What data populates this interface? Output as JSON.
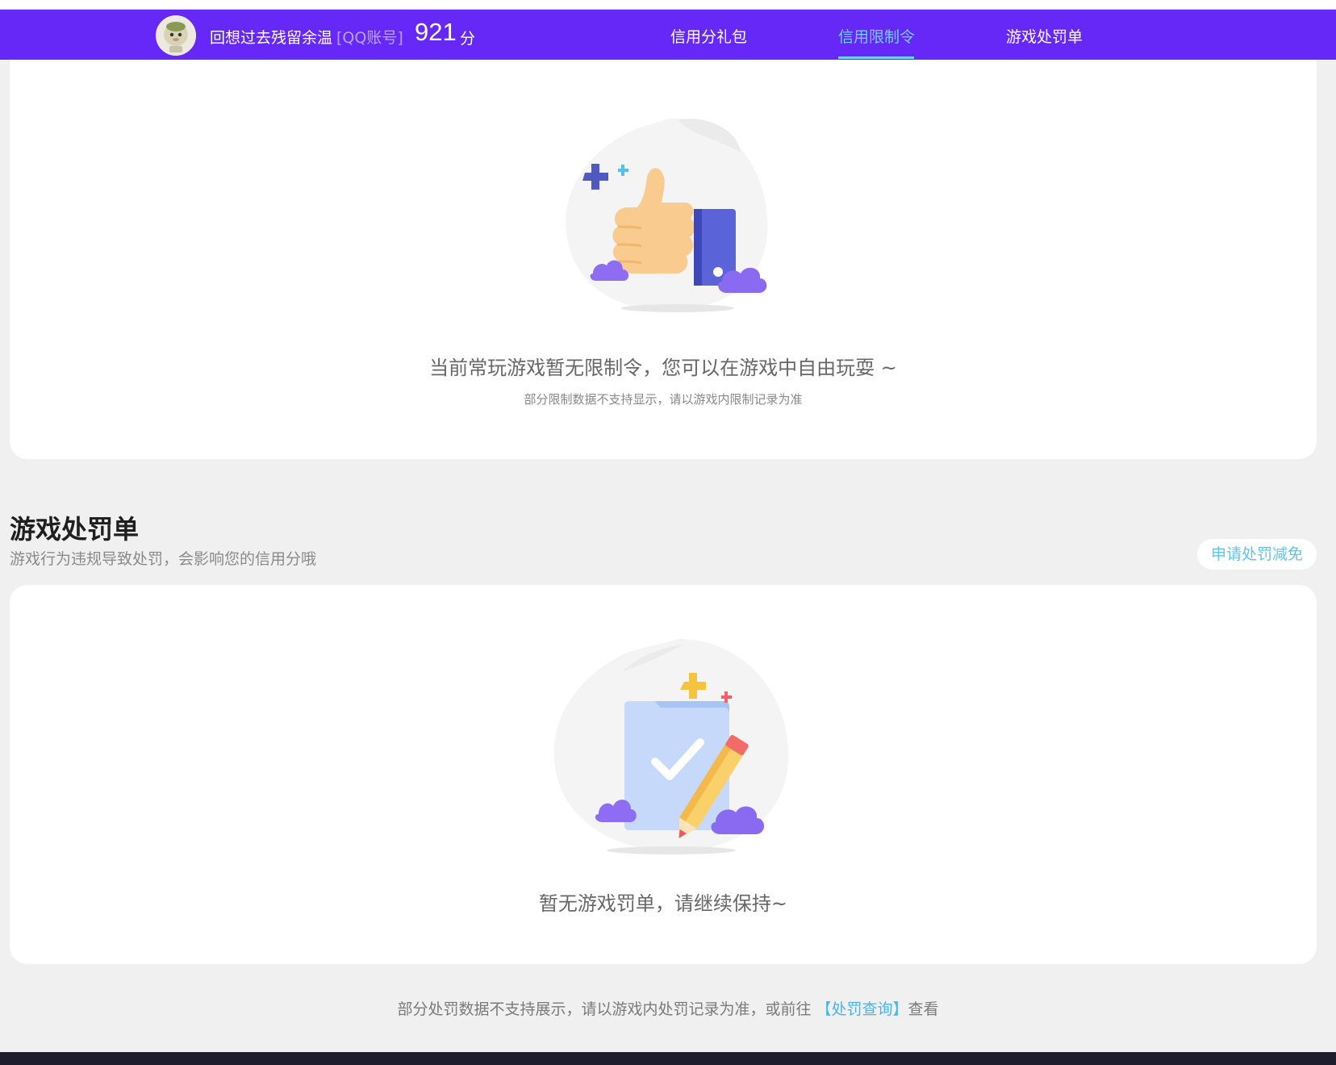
{
  "header": {
    "user_name": "回想过去残留余温",
    "account_type": "[QQ账号]",
    "score": "921",
    "score_unit": "分",
    "nav": [
      {
        "label": "信用分礼包",
        "active": false
      },
      {
        "label": "信用限制令",
        "active": true
      },
      {
        "label": "游戏处罚单",
        "active": false
      }
    ]
  },
  "restriction": {
    "empty_title": "当前常玩游戏暂无限制令，您可以在游戏中自由玩耍 ~",
    "empty_note": "部分限制数据不支持显示，请以游戏内限制记录为准"
  },
  "penalty": {
    "title": "游戏处罚单",
    "subtitle": "游戏行为违规导致处罚，会影响您的信用分哦",
    "appeal_label": "申请处罚减免",
    "empty_title": "暂无游戏罚单，请继续保持~"
  },
  "footer": {
    "note_prefix": "部分处罚数据不支持展示，请以游戏内处罚记录为准，或前往 ",
    "link_label": "【处罚查询】",
    "note_suffix": "查看"
  },
  "colors": {
    "header_bg": "#6528f7",
    "active_nav": "#6fd0ff",
    "link": "#4ab4e8",
    "page_bg": "#f0f0f0"
  }
}
